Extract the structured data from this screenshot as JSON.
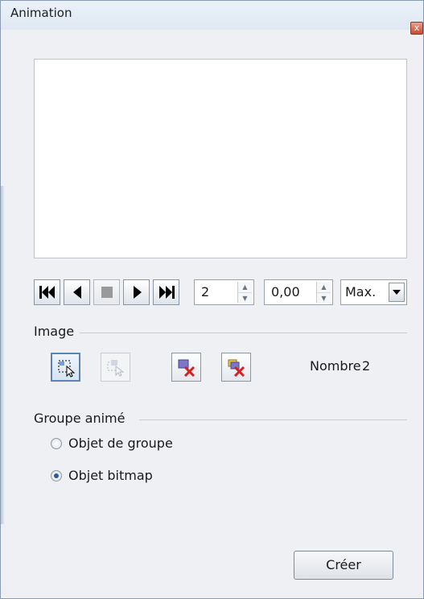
{
  "window": {
    "title": "Animation",
    "close_glyph": "x"
  },
  "playback": {
    "buttons": [
      "first-frame-icon",
      "previous-frame-icon",
      "stop-icon",
      "play-icon",
      "last-frame-icon"
    ],
    "image_number": "2",
    "duration": "0,00",
    "loop_count": "Max."
  },
  "image_section": {
    "label": "Image",
    "tools": [
      "apply-object-icon",
      "apply-objects-individually-icon",
      "delete-current-image-icon",
      "delete-all-images-icon"
    ],
    "count_label": "Nombre",
    "count_value": "2"
  },
  "group_section": {
    "label": "Groupe animé",
    "options": [
      {
        "label": "Objet de groupe",
        "checked": false
      },
      {
        "label": "Objet bitmap",
        "checked": true
      }
    ]
  },
  "create_button": {
    "label": "Créer"
  }
}
